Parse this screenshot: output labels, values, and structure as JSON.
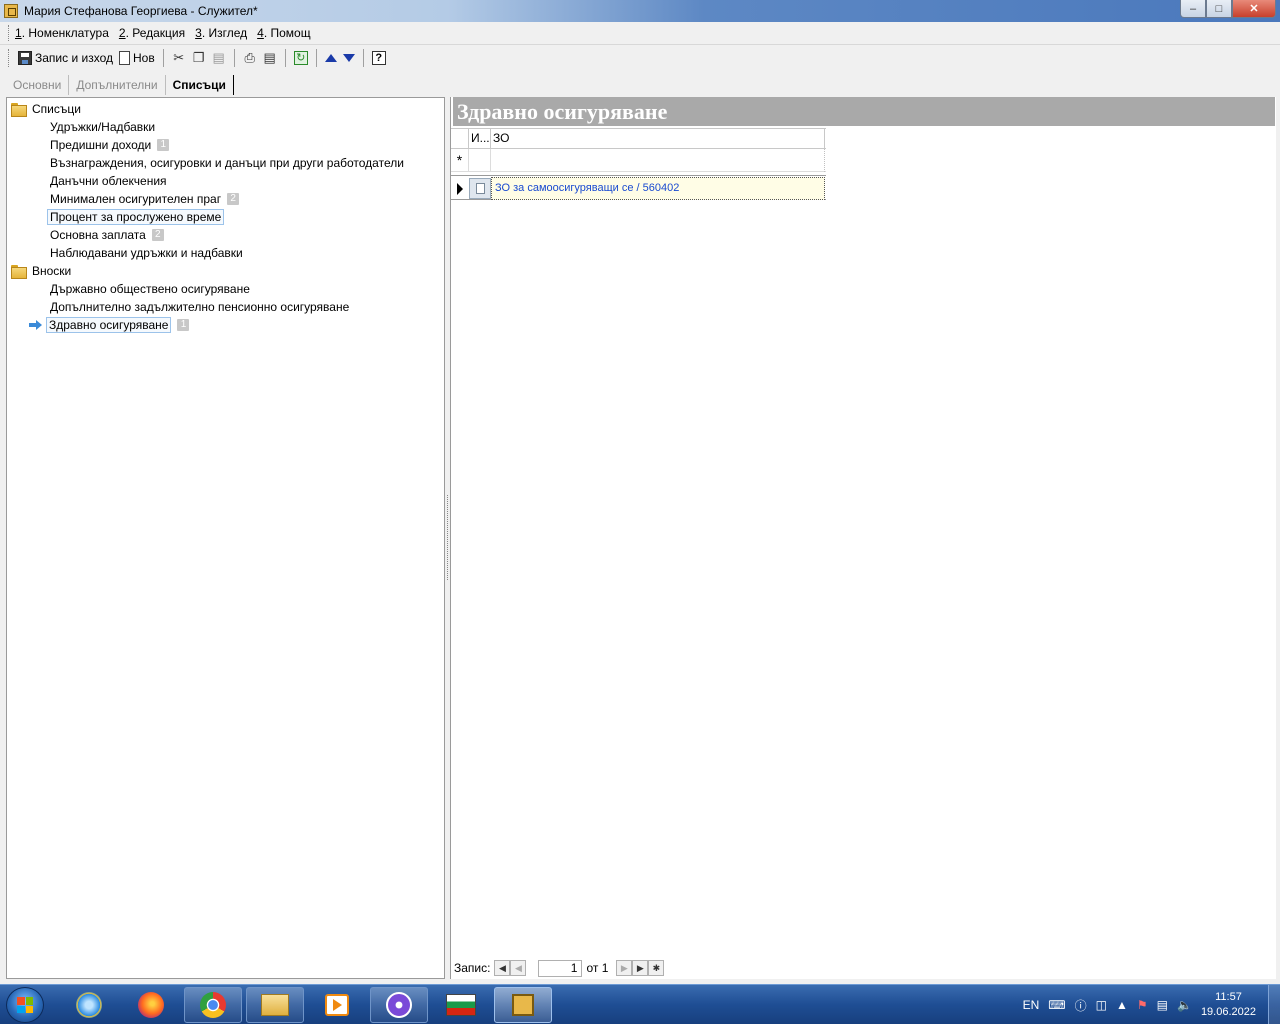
{
  "window": {
    "title": "Мария Стефанова Георгиева - Служител*"
  },
  "menu": [
    {
      "acc": "1",
      "label": ". Номенклатура"
    },
    {
      "acc": "2",
      "label": ". Редакция"
    },
    {
      "acc": "3",
      "label": ". Изглед"
    },
    {
      "acc": "4",
      "label": ". Помощ"
    }
  ],
  "toolbar": {
    "save_exit": "Запис и изход",
    "new": "Нов"
  },
  "tabs": [
    "Основни",
    "Допълнителни",
    "Списъци"
  ],
  "tree": {
    "groups": [
      {
        "label": "Списъци",
        "items": [
          {
            "label": "Удръжки/Надбавки",
            "badge": ""
          },
          {
            "label": "Предишни доходи",
            "badge": "1"
          },
          {
            "label": "Възнаграждения, осигуровки и данъци при други работодатели",
            "badge": ""
          },
          {
            "label": "Данъчни облекчения",
            "badge": ""
          },
          {
            "label": "Минимален осигурителен праг",
            "badge": "2"
          },
          {
            "label": "Процент за прослужено време",
            "badge": ""
          },
          {
            "label": "Основна заплата",
            "badge": "2"
          },
          {
            "label": "Наблюдавани удръжки и надбавки",
            "badge": ""
          }
        ]
      },
      {
        "label": "Вноски",
        "items": [
          {
            "label": "Държавно обществено осигуряване",
            "badge": ""
          },
          {
            "label": "Допълнително задължително пенсионно осигуряване",
            "badge": ""
          },
          {
            "label": "Здравно осигуряване",
            "badge": "1"
          }
        ]
      }
    ]
  },
  "detail": {
    "title": "Здравно осигуряване",
    "columns": [
      "И...",
      "ЗО"
    ],
    "new_row_marker": "*",
    "rows": [
      {
        "zo": "ЗО за самоосигуряващи се / 560402"
      }
    ]
  },
  "navigator": {
    "label": "Запис:",
    "current": "1",
    "of": "от 1"
  },
  "taskbar": {
    "lang": "EN",
    "time": "11:57",
    "date": "19.06.2022"
  }
}
